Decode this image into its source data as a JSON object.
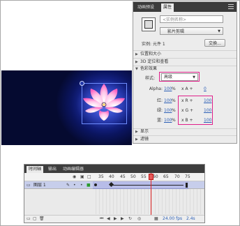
{
  "properties_panel": {
    "tabs": [
      "动画预设",
      "属性"
    ],
    "active_tab": "属性",
    "instance_name_placeholder": "<实例名称>",
    "instance_type": "影片剪辑",
    "instance_of_label": "实例:",
    "instance_of_value": "元件 1",
    "swap_button": "交换...",
    "sections": {
      "position_size": "位置和大小",
      "3d": "3D 定位和查看",
      "color_effect": "色彩效果",
      "display": "显示",
      "filters": "滤镜"
    },
    "style_label": "样式:",
    "style_value": "高级",
    "alpha": {
      "label": "Alpha:",
      "percent": "100",
      "unit": "%",
      "x": "x A +",
      "offset": "0"
    },
    "red": {
      "label": "红:",
      "percent": "100",
      "unit": "%",
      "x": "x R +",
      "offset": "100"
    },
    "green": {
      "label": "绿:",
      "percent": "100",
      "unit": "%",
      "x": "x G +",
      "offset": "100"
    },
    "blue": {
      "label": "蓝:",
      "percent": "100",
      "unit": "%",
      "x": "x B +",
      "offset": "100"
    },
    "highlight_color": "#e0208a"
  },
  "timeline": {
    "tabs": [
      "时间轴",
      "输出",
      "动画编辑器"
    ],
    "active_tab": "时间轴",
    "frame_numbers": [
      "35",
      "40",
      "45",
      "50",
      "55",
      "60",
      "65",
      "70",
      "75"
    ],
    "layer_name": "图层 1",
    "footer": {
      "fps": "24.00 fps",
      "time": "2.4s"
    },
    "playhead_color": "#e32424",
    "tween_color": "#b7bce8"
  },
  "stage": {
    "background_color": "#0b1560",
    "symbol": "lotus-flower"
  }
}
